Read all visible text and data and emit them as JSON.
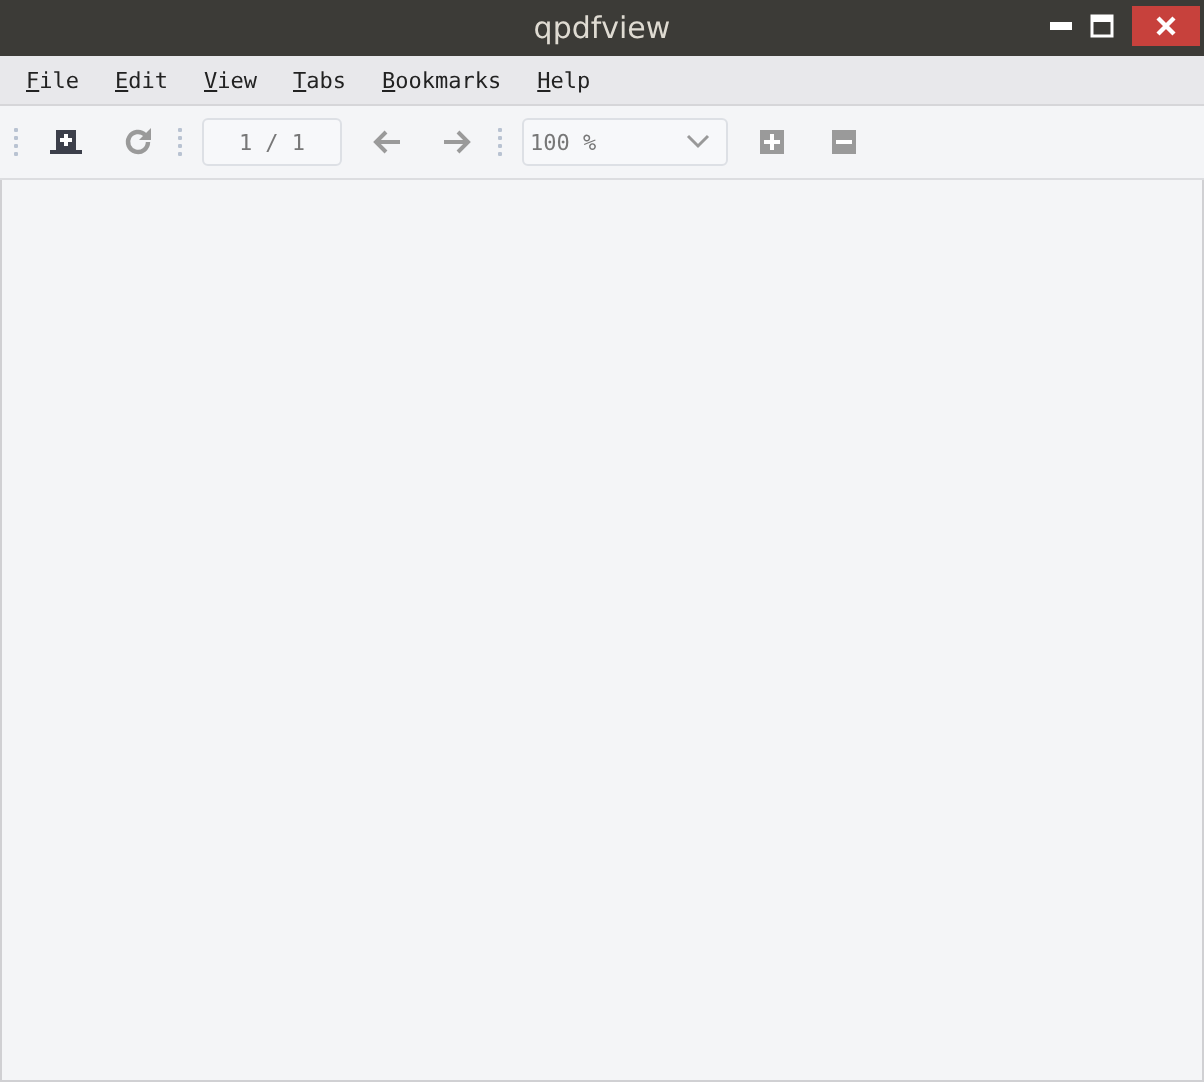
{
  "window": {
    "title": "qpdfview"
  },
  "menu": [
    {
      "label": "File"
    },
    {
      "label": "Edit"
    },
    {
      "label": "View"
    },
    {
      "label": "Tabs"
    },
    {
      "label": "Bookmarks"
    },
    {
      "label": "Help"
    }
  ],
  "toolbar": [
    {
      "kind": "grip"
    },
    {
      "kind": "open",
      "disabled": false
    },
    {
      "kind": "reload",
      "disabled": true
    },
    {
      "kind": "grip"
    },
    {
      "kind": "page",
      "value": "1 / 1"
    },
    {
      "kind": "previous",
      "disabled": true
    },
    {
      "kind": "next",
      "disabled": true
    },
    {
      "kind": "grip"
    },
    {
      "kind": "zoom",
      "value": "100 %"
    },
    {
      "kind": "zoom-in",
      "disabled": true
    },
    {
      "kind": "zoom-out",
      "disabled": true
    }
  ]
}
